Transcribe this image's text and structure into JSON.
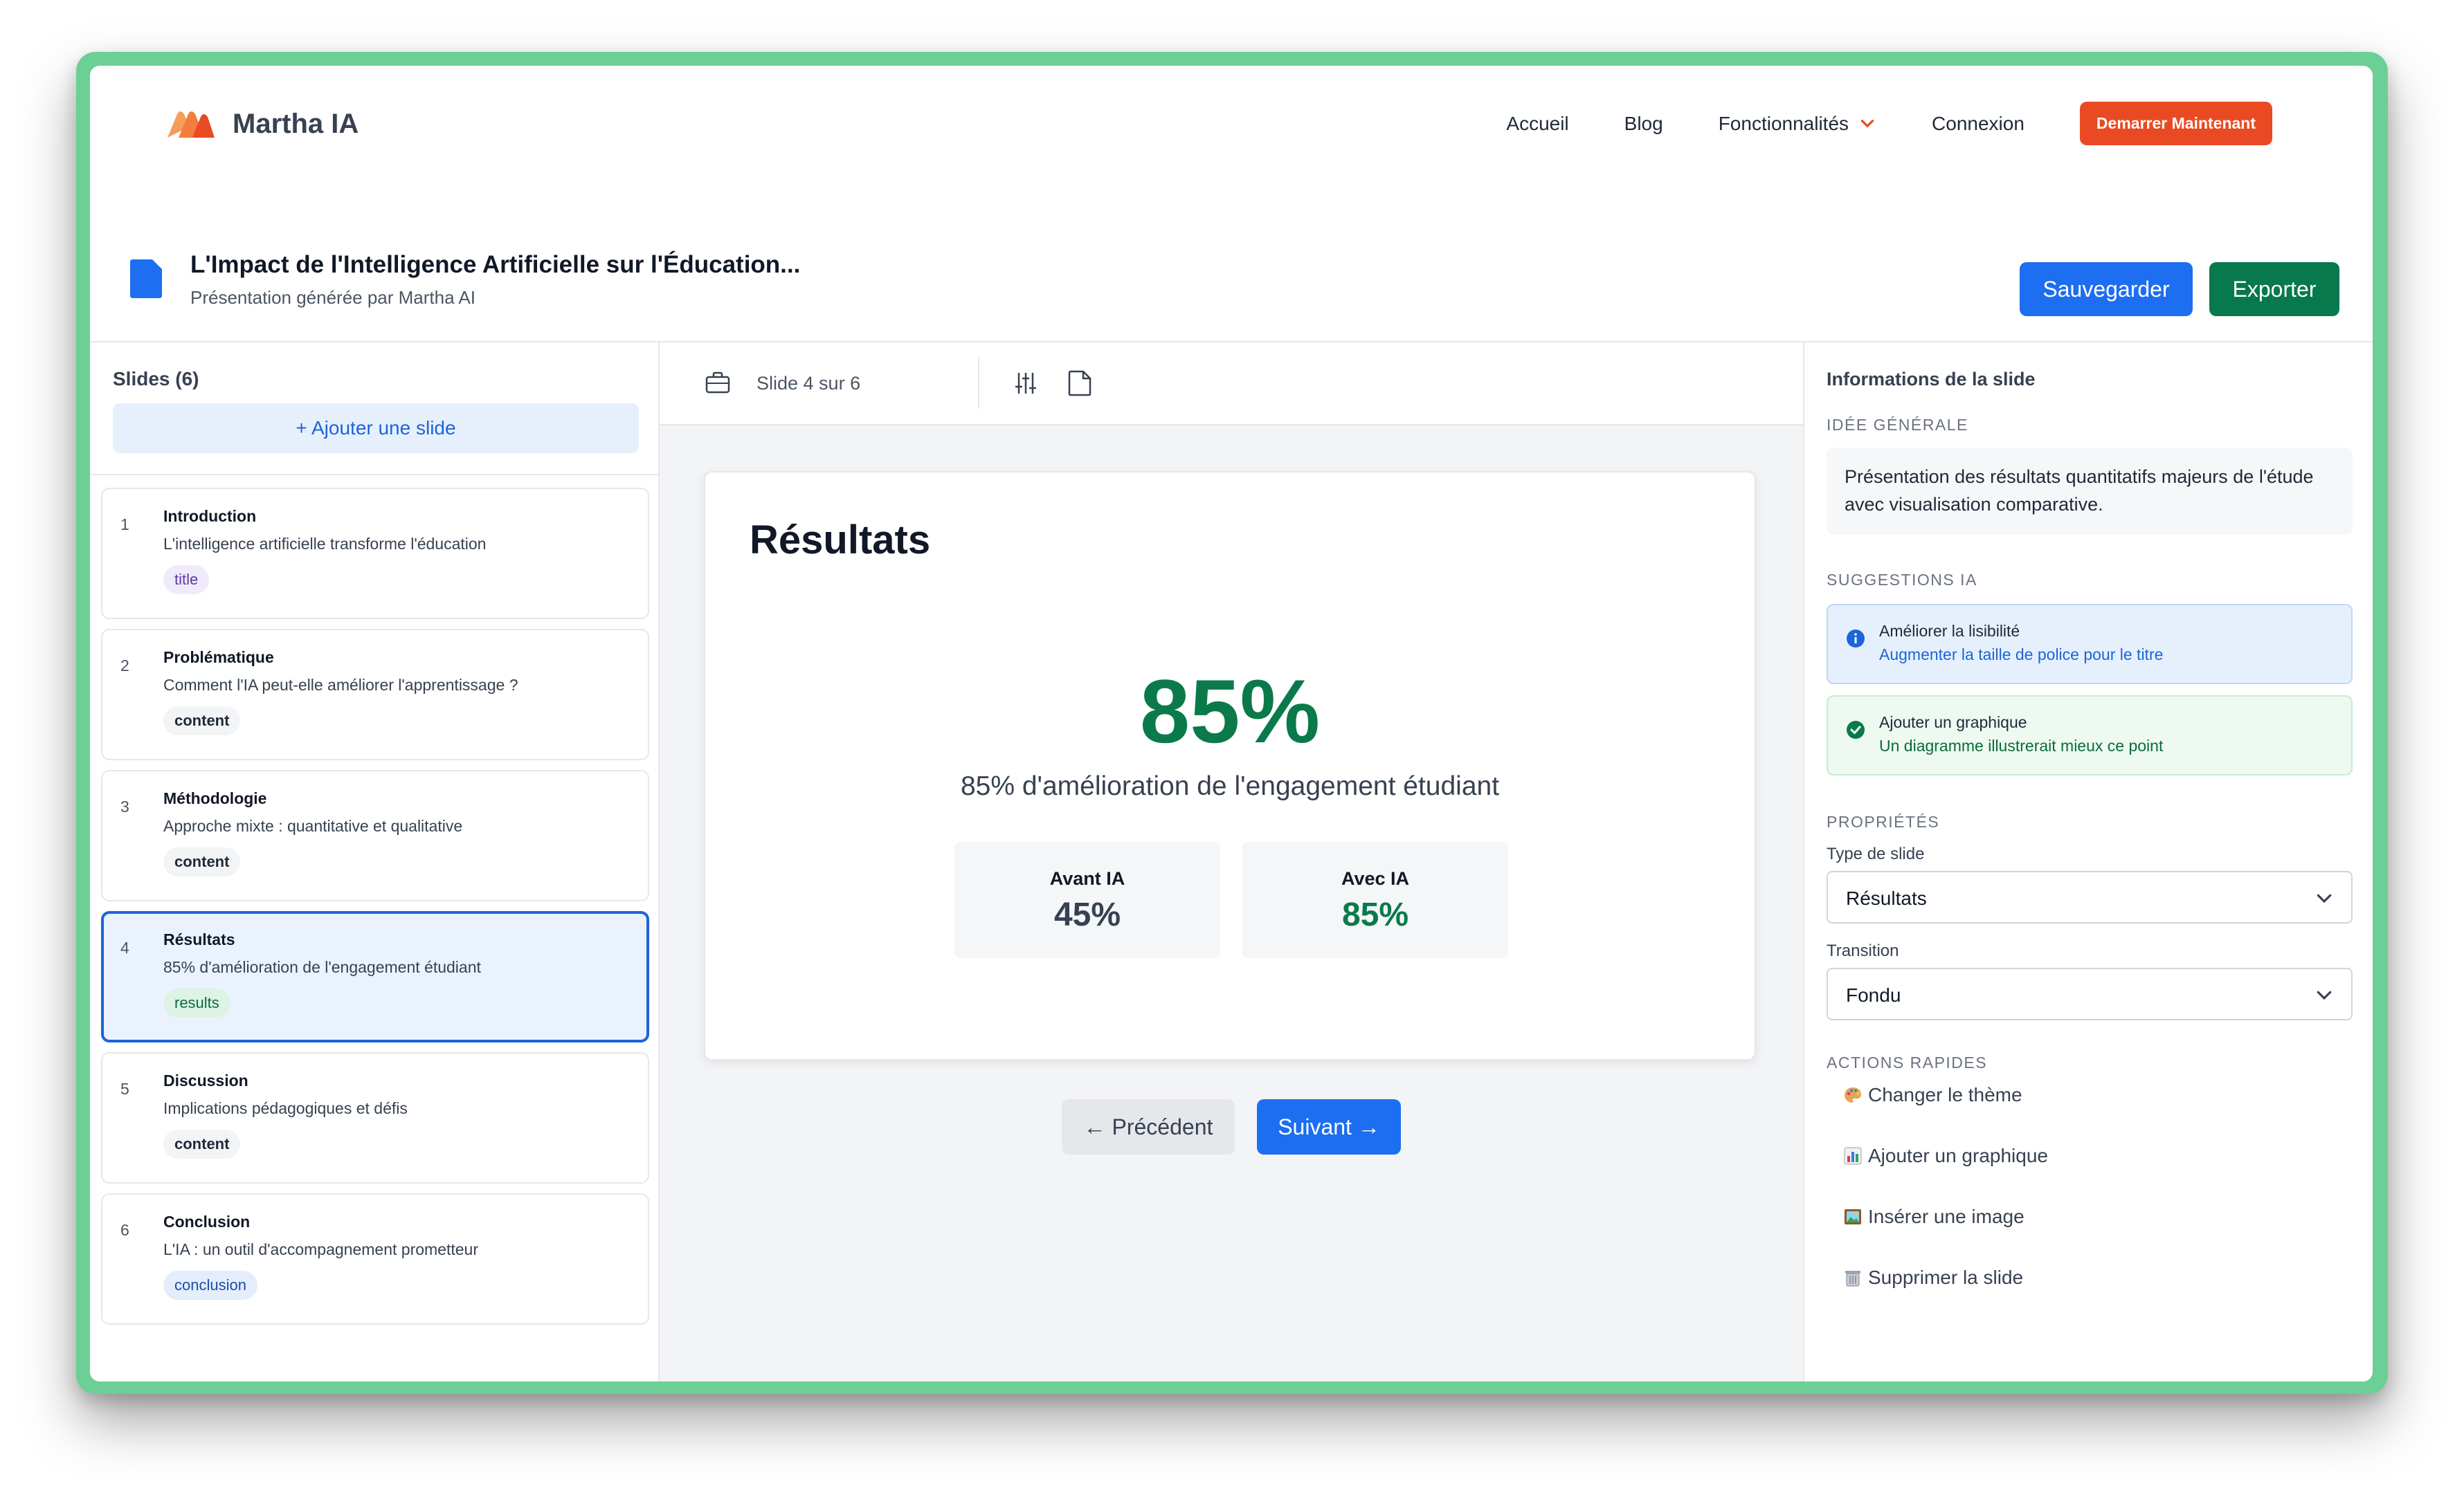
{
  "brand": {
    "name": "Martha IA",
    "accent": "#ea4a23"
  },
  "nav": {
    "links": [
      "Accueil",
      "Blog",
      "Fonctionnalités",
      "Connexion"
    ],
    "cta": "Demarrer Maintenant"
  },
  "doc": {
    "title": "L'Impact de l'Intelligence Artificielle sur l'Éducation...",
    "subtitle": "Présentation générée par Martha AI",
    "save": "Sauvegarder",
    "export": "Exporter"
  },
  "sidebar": {
    "title": "Slides (6)",
    "add": "+ Ajouter une slide",
    "slides": [
      {
        "num": "1",
        "name": "Introduction",
        "desc": "L'intelligence artificielle transforme l'éducation",
        "tag": "title"
      },
      {
        "num": "2",
        "name": "Problématique",
        "desc": "Comment l'IA peut-elle améliorer l'apprentissage ?",
        "tag": "content"
      },
      {
        "num": "3",
        "name": "Méthodologie",
        "desc": "Approche mixte : quantitative et qualitative",
        "tag": "content"
      },
      {
        "num": "4",
        "name": "Résultats",
        "desc": "85% d'amélioration de l'engagement étudiant",
        "tag": "results"
      },
      {
        "num": "5",
        "name": "Discussion",
        "desc": "Implications pédagogiques et défis",
        "tag": "content"
      },
      {
        "num": "6",
        "name": "Conclusion",
        "desc": "L'IA : un outil d'accompagnement prometteur",
        "tag": "conclusion"
      }
    ],
    "active_index": 3
  },
  "editor": {
    "counter": "Slide 4 sur 6",
    "slide": {
      "title": "Résultats",
      "big_stat": "85%",
      "caption": "85% d'amélioration de l'engagement étudiant",
      "before": {
        "label": "Avant IA",
        "value": "45%"
      },
      "after": {
        "label": "Avec IA",
        "value": "85%"
      }
    },
    "prev": "← Précédent",
    "next": "Suivant →"
  },
  "info": {
    "title": "Informations de la slide",
    "idea_label": "IDÉE GÉNÉRALE",
    "idea_text": "Présentation des résultats quantitatifs majeurs de l'étude avec visualisation comparative.",
    "suggestions_label": "SUGGESTIONS IA",
    "suggestions": [
      {
        "title": "Améliorer la lisibilité",
        "sub": "Augmenter la taille de police pour le titre",
        "icon": "info-icon"
      },
      {
        "title": "Ajouter un graphique",
        "sub": "Un diagramme illustrerait mieux ce point",
        "icon": "check-circle-icon"
      }
    ],
    "properties_label": "PROPRIÉTÉS",
    "slide_type_label": "Type de slide",
    "slide_type_value": "Résultats",
    "transition_label": "Transition",
    "transition_value": "Fondu",
    "quick_actions_label": "ACTIONS RAPIDES",
    "quick_actions": [
      {
        "label": "Changer le thème",
        "icon": "palette-icon"
      },
      {
        "label": "Ajouter un graphique",
        "icon": "bar-chart-icon"
      },
      {
        "label": "Insérer une image",
        "icon": "picture-icon"
      },
      {
        "label": "Supprimer la slide",
        "icon": "trash-icon"
      }
    ]
  },
  "colors": {
    "primary": "#1d6ef0",
    "success": "#0b7a4b",
    "frame": "#6ccf95"
  }
}
